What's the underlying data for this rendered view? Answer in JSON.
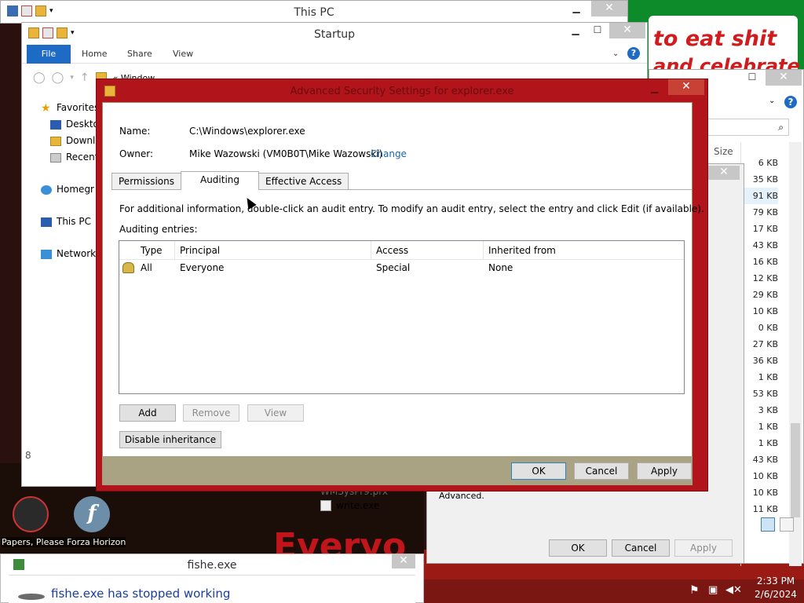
{
  "windows": {
    "this_pc": {
      "title": "This PC"
    },
    "startup": {
      "title": "Startup",
      "ribbon": {
        "file": "File",
        "home": "Home",
        "share": "Share",
        "view": "View"
      },
      "address_fragment": "Window",
      "nav": {
        "favorites": "Favorites",
        "desktop": "Deskto",
        "downloads": "Downlo",
        "recent": "Recent",
        "homegroup": "Homegr",
        "this_pc": "This PC",
        "network": "Network"
      }
    },
    "right_pane": {
      "size_header": "Size",
      "sizes": [
        "6 KB",
        "35 KB",
        "91 KB",
        "79 KB",
        "17 KB",
        "43 KB",
        "16 KB",
        "12 KB",
        "29 KB",
        "10 KB",
        "0 KB",
        "27 KB",
        "36 KB",
        "1 KB",
        "53 KB",
        "3 KB",
        "1 KB",
        "1 KB",
        "43 KB",
        "10 KB",
        "10 KB",
        "11 KB"
      ]
    },
    "properties": {
      "advanced_label": "Advanced.",
      "ok": "OK",
      "cancel": "Cancel",
      "apply": "Apply"
    },
    "bg_list": {
      "file1": "WMSysPr9.prx",
      "file2": "write.exe"
    }
  },
  "dialog": {
    "title": "Advanced Security Settings for explorer.exe",
    "name_label": "Name:",
    "name_value": "C:\\Windows\\explorer.exe",
    "owner_label": "Owner:",
    "owner_value": "Mike Wazowski (VM0B0T\\Mike Wazowski)",
    "owner_change": "Change",
    "tabs": [
      "Permissions",
      "Auditing",
      "Effective Access"
    ],
    "selected_tab": "Auditing",
    "info_text": "For additional information, double-click an audit entry. To modify an audit entry, select the entry and click Edit (if available).",
    "entries_label": "Auditing entries:",
    "columns": [
      "Type",
      "Principal",
      "Access",
      "Inherited from"
    ],
    "rows": [
      {
        "type": "All",
        "principal": "Everyone",
        "access": "Special",
        "inherited": "None"
      }
    ],
    "buttons": {
      "add": "Add",
      "remove": "Remove",
      "view": "View",
      "disable_inheritance": "Disable inheritance"
    },
    "footer": {
      "ok": "OK",
      "cancel": "Cancel",
      "apply": "Apply"
    }
  },
  "desktop": {
    "wallpaper_text_1": "to eat shit",
    "wallpaper_text_2": "and celebrate",
    "wallpaper_text_3": "Everyo",
    "icon1_label": "Papers, Please",
    "icon2_label": "Forza Horizon",
    "left_fragment": "8"
  },
  "crash_window": {
    "title": "fishe.exe",
    "message": "fishe.exe has stopped working"
  },
  "taskbar": {
    "time": "2:33 PM",
    "date": "2/6/2024"
  }
}
